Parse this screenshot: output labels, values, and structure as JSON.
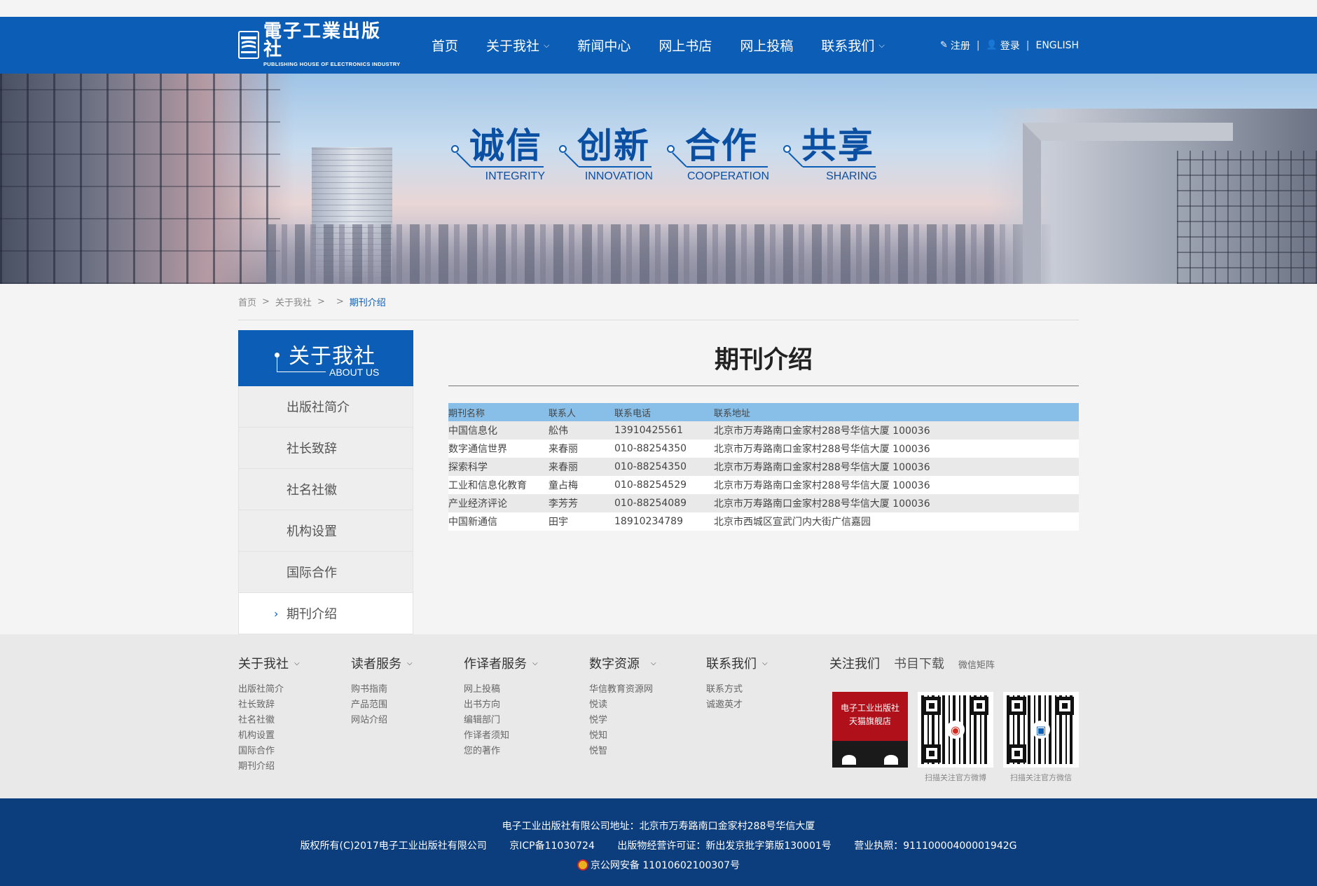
{
  "header": {
    "logo_cn": "電子工業出版社",
    "logo_en": "PUBLISHING HOUSE OF ELECTRONICS INDUSTRY",
    "nav": [
      {
        "label": "首页",
        "has_dropdown": false
      },
      {
        "label": "关于我社",
        "has_dropdown": true
      },
      {
        "label": "新闻中心",
        "has_dropdown": false
      },
      {
        "label": "网上书店",
        "has_dropdown": false
      },
      {
        "label": "网上投稿",
        "has_dropdown": false
      },
      {
        "label": "联系我们",
        "has_dropdown": true
      }
    ],
    "register": "注册",
    "login": "登录",
    "english": "ENGLISH"
  },
  "banner": {
    "slogans": [
      {
        "cn": "诚信",
        "en": "INTEGRITY"
      },
      {
        "cn": "创新",
        "en": "INNOVATION"
      },
      {
        "cn": "合作",
        "en": "COOPERATION"
      },
      {
        "cn": "共享",
        "en": "SHARING"
      }
    ]
  },
  "breadcrumb": {
    "home": "首页",
    "section": "关于我社",
    "current": "期刊介绍"
  },
  "sidebar": {
    "title_cn": "关于我社",
    "title_en": "ABOUT US",
    "items": [
      {
        "label": "出版社简介"
      },
      {
        "label": "社长致辞"
      },
      {
        "label": "社名社徽"
      },
      {
        "label": "机构设置"
      },
      {
        "label": "国际合作"
      },
      {
        "label": "期刊介绍",
        "active": true
      }
    ]
  },
  "content": {
    "title": "期刊介绍",
    "table": {
      "headers": [
        "期刊名称",
        "联系人",
        "联系电话",
        "联系地址"
      ],
      "rows": [
        [
          "中国信息化",
          "舩伟",
          "13910425561",
          "北京市万寿路南口金家村288号华信大厦 100036"
        ],
        [
          "数字通信世界",
          "来春丽",
          "010-88254350",
          "北京市万寿路南口金家村288号华信大厦 100036"
        ],
        [
          "探索科学",
          "来春丽",
          "010-88254350",
          "北京市万寿路南口金家村288号华信大厦 100036"
        ],
        [
          "工业和信息化教育",
          "童占梅",
          "010-88254529",
          "北京市万寿路南口金家村288号华信大厦 100036"
        ],
        [
          "产业经济评论",
          "李芳芳",
          "010-88254089",
          "北京市万寿路南口金家村288号华信大厦 100036"
        ],
        [
          "中国新通信",
          "田宇",
          "18910234789",
          "北京市西城区宣武门内大街广信嘉园"
        ]
      ]
    }
  },
  "footer_nav": {
    "columns": [
      {
        "title": "关于我社",
        "links": [
          "出版社简介",
          "社长致辞",
          "社名社徽",
          "机构设置",
          "国际合作",
          "期刊介绍"
        ]
      },
      {
        "title": "读者服务",
        "links": [
          "购书指南",
          "产品范围",
          "网站介绍"
        ]
      },
      {
        "title": "作译者服务",
        "links": [
          "网上投稿",
          "出书方向",
          "编辑部门",
          "作译者须知",
          "您的著作"
        ]
      },
      {
        "title": "数字资源",
        "links": [
          "华信教育资源网",
          "悦读",
          "悦学",
          "悦知",
          "悦智"
        ]
      },
      {
        "title": "联系我们",
        "links": [
          "联系方式",
          "诚邀英才"
        ]
      }
    ],
    "follow": {
      "tab_follow": "关注我们",
      "tab_catalog": "书目下载",
      "tab_wechat": "微信矩阵",
      "tmall_line1": "电子工业出版社",
      "tmall_line2": "天猫旗舰店",
      "weibo_caption": "扫描关注官方微博",
      "wechat_caption": "扫描关注官方微信"
    }
  },
  "footer": {
    "address": "电子工业出版社有限公司地址：北京市万寿路南口金家村288号华信大厦",
    "copyright": "版权所有(C)2017电子工业出版社有限公司",
    "icp": "京ICP备11030724",
    "license": "出版物经营许可证：新出发京批字第版130001号",
    "business": "营业执照：91110000400001942G",
    "police": "京公网安备 11010602100307号"
  }
}
